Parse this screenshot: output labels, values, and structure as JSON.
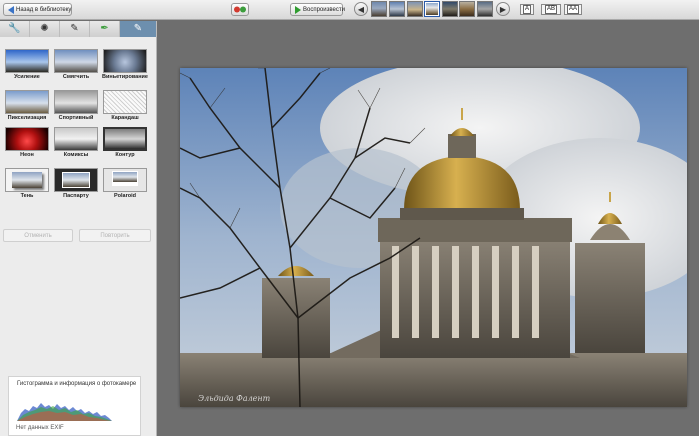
{
  "toolbar": {
    "back_label": "Назад в библиотеку",
    "play_label": "Воспроизвести",
    "prev_icon": "arrow-left-icon",
    "next_icon": "arrow-right-icon",
    "size_small": "A",
    "size_medium": "AB",
    "size_large": "AA",
    "thumbnail_count": 8,
    "selected_thumbnail": 4
  },
  "tabs": [
    {
      "icon": "wrench-icon"
    },
    {
      "icon": "sparkle-icon"
    },
    {
      "icon": "brush-icon"
    },
    {
      "icon": "paint-icon"
    },
    {
      "icon": "frame-icon"
    }
  ],
  "effects": [
    {
      "label": "Усиление"
    },
    {
      "label": "Смягчить"
    },
    {
      "label": "Виньетирование"
    },
    {
      "label": "Пикселизация"
    },
    {
      "label": "Спортивный"
    },
    {
      "label": "Карандаш"
    },
    {
      "label": "Неон"
    },
    {
      "label": "Комиксы"
    },
    {
      "label": "Контур"
    },
    {
      "label": "Тень"
    },
    {
      "label": "Паспарту"
    },
    {
      "label": "Polaroid"
    }
  ],
  "actions": {
    "undo_label": "Отменить",
    "redo_label": "Повторить"
  },
  "histogram": {
    "title": "Гистограмма и информация о фотокамере",
    "no_exif": "Нет данных EXIF"
  },
  "photo": {
    "signature": "Эльдида Фалент"
  },
  "colors": {
    "accent": "#3a73c6",
    "active_tab": "#6d8fae",
    "canvas_bg": "#6e6e6e"
  }
}
